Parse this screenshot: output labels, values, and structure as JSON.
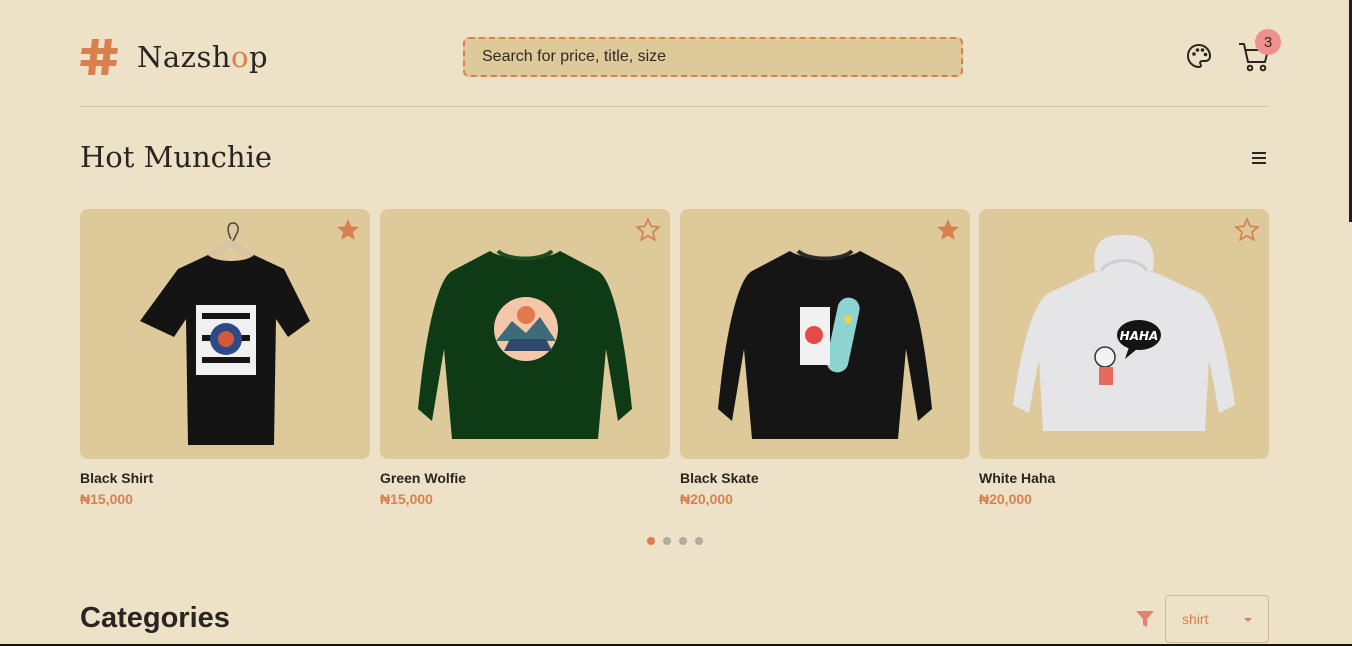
{
  "brand": {
    "name_part1": "Naz",
    "name_part2": "sh",
    "name_accent": "o",
    "name_part3": "p"
  },
  "search": {
    "placeholder": "Search for price, title, size"
  },
  "header": {
    "palette_icon": "palette-icon",
    "cart_icon": "cart-icon",
    "cart_count": "3"
  },
  "section": {
    "title": "Hot Munchie",
    "menu_icon": "menu-icon"
  },
  "products": [
    {
      "name": "Black Shirt",
      "price": "₦15,000",
      "favorite": true,
      "garment": "t-shirt",
      "color": "#141414"
    },
    {
      "name": "Green Wolfie",
      "price": "₦15,000",
      "favorite": false,
      "garment": "sweatshirt",
      "color": "#0e3a16"
    },
    {
      "name": "Black Skate",
      "price": "₦20,000",
      "favorite": true,
      "garment": "sweatshirt",
      "color": "#151515"
    },
    {
      "name": "White Haha",
      "price": "₦20,000",
      "favorite": false,
      "garment": "hoodie",
      "color": "#e5e5e7",
      "print_text": "HAHA"
    }
  ],
  "carousel": {
    "pages": 4,
    "active": 0
  },
  "categories": {
    "title": "Categories",
    "filter_icon": "filter-icon",
    "selected": "shirt"
  },
  "colors": {
    "background": "#ede1c8",
    "card": "#ddc99a",
    "accent": "#d8814e",
    "badge": "#f08f8c",
    "text": "#2a2521"
  }
}
